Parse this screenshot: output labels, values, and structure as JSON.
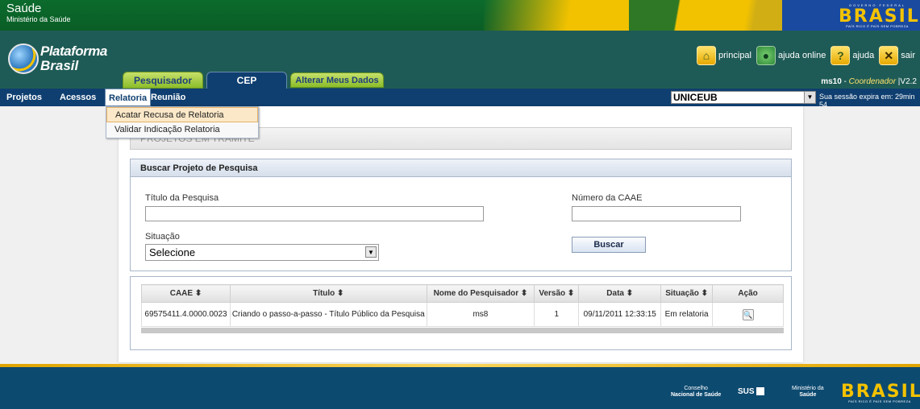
{
  "gov_bar": {
    "title": "Saúde",
    "subtitle": "Ministério da Saúde",
    "brasil_word": "BRASIL",
    "brasil_top": "GOVERNO FEDERAL",
    "brasil_tag": "PAÍS RICO É PAÍS SEM POBREZA"
  },
  "logo": {
    "line1": "Plataforma",
    "line2": "Brasil"
  },
  "tabs": [
    {
      "label": "Pesquisador"
    },
    {
      "label": "CEP"
    },
    {
      "label": "Alterar Meus Dados"
    }
  ],
  "header_buttons": [
    {
      "label": "principal",
      "icon": "home-icon"
    },
    {
      "label": "ajuda online",
      "icon": "online-help-icon"
    },
    {
      "label": "ajuda",
      "icon": "help-icon"
    },
    {
      "label": "sair",
      "icon": "exit-icon"
    }
  ],
  "user": {
    "login": "ms10",
    "role": "Coordenador",
    "version": "V2.2"
  },
  "menu": [
    {
      "label": "Projetos"
    },
    {
      "label": "Acessos"
    },
    {
      "label": "Relatoria"
    },
    {
      "label": "Reunião"
    }
  ],
  "dropdown": [
    {
      "label": "Acatar Recusa de Relatoria"
    },
    {
      "label": "Validar Indicação Relatoria"
    }
  ],
  "institution": {
    "selected": "UNICEUB"
  },
  "session": {
    "text": "Sua sessão expira em: 29min 54"
  },
  "page": {
    "title": "PROJETOS EM TRÂMITE"
  },
  "search": {
    "header": "Buscar Projeto de Pesquisa",
    "title_label": "Título da Pesquisa",
    "title_value": "",
    "caae_label": "Número da CAAE",
    "caae_value": "",
    "situacao_label": "Situação",
    "situacao_selected": "Selecione",
    "button": "Buscar"
  },
  "table": {
    "headers": [
      "CAAE ⬍",
      "Título ⬍",
      "Nome do Pesquisador ⬍",
      "Versão ⬍",
      "Data ⬍",
      "Situação ⬍",
      "Ação"
    ],
    "rows": [
      [
        "69575411.4.0000.0023",
        "Criando o passo-a-passo - Título Público da Pesquisa",
        "ms8",
        "1",
        "09/11/2011 12:33:15",
        "Em relatoria"
      ]
    ]
  },
  "footer": {
    "conselho_line1": "Conselho",
    "conselho_line2": "Nacional de Saúde",
    "sus": "SUS",
    "ministerio_line1": "Ministério da",
    "ministerio_line2": "Saúde",
    "brasil_word": "BRASIL",
    "brasil_tag": "PAÍS RICO É PAÍS SEM POBREZA"
  },
  "colors": {
    "gov_green": "#0b6b2c",
    "header_teal": "#1f5b56",
    "menu_blue": "#0f3f70",
    "footer_blue": "#0d4a70",
    "gold": "#f2c200"
  }
}
